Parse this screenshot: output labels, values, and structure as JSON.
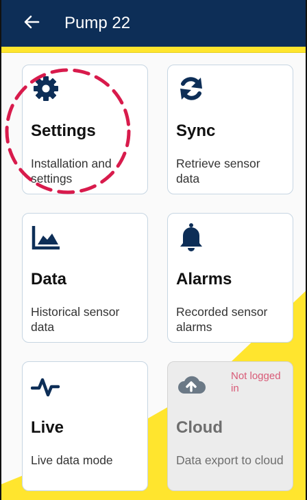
{
  "header": {
    "title": "Pump 22",
    "back_icon": "arrow-left-icon",
    "background": "#0d2e57",
    "accent": "#ffe52e"
  },
  "cards": [
    {
      "title": "Settings",
      "subtitle": "Installation and settings",
      "icon": "gear-icon"
    },
    {
      "title": "Sync",
      "subtitle": "Retrieve sensor data",
      "icon": "sync-icon"
    },
    {
      "title": "Data",
      "subtitle": "Historical sensor data",
      "icon": "area-chart-icon"
    },
    {
      "title": "Alarms",
      "subtitle": "Recorded sensor alarms",
      "icon": "bell-icon"
    },
    {
      "title": "Live",
      "subtitle": "Live data mode",
      "icon": "pulse-icon"
    },
    {
      "title": "Cloud",
      "subtitle": "Data export to cloud",
      "icon": "cloud-upload-icon",
      "status": "Not logged in",
      "disabled": true
    }
  ],
  "colors": {
    "icon": "#0d2e57",
    "highlight": "#d81b4c",
    "status": "#d85a77"
  }
}
